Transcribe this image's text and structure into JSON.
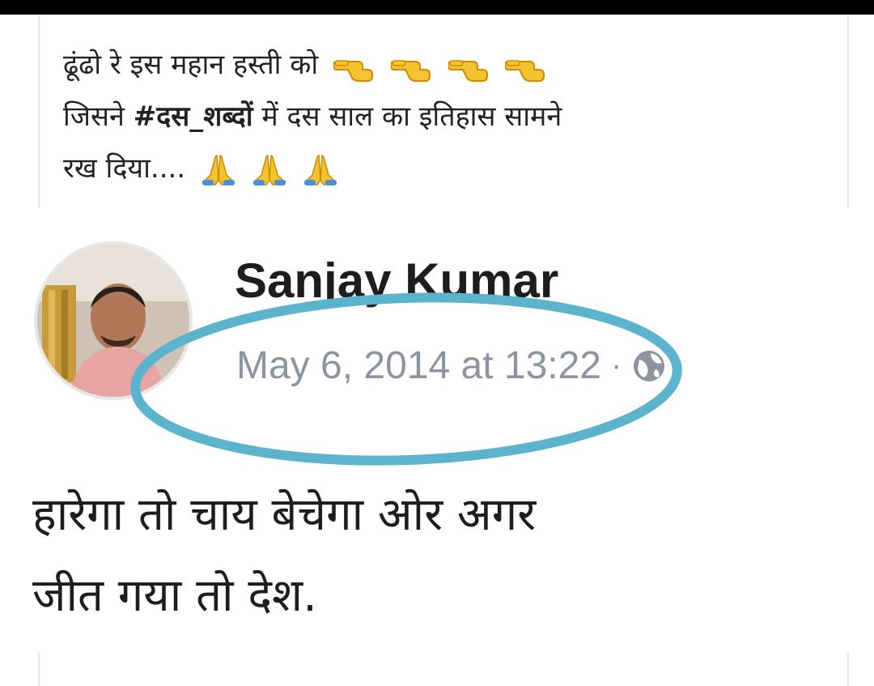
{
  "post": {
    "line1": "ढूंढो रे इस महान हस्ती को",
    "line2_before": "जिसने ",
    "line2_tag": "#दस_शब्दों",
    "line2_after": " में  दस साल का इतिहास सामने",
    "line3": "रख दिया....",
    "pointing_emoji_icon": "backhand-index-pointing-left-icon",
    "pointing_emoji_count": 4,
    "folded_hands_icon": "folded-hands-icon",
    "folded_hands_count": 3
  },
  "screenshot": {
    "author": "Sanjay Kumar",
    "timestamp": "May 6, 2014 at 13:22",
    "separator": "·",
    "privacy_icon": "globe-icon",
    "text_line1": "हारेगा तो चाय बेचेगा ओर अगर",
    "text_line2": "जीत गया तो देश.",
    "highlight_color": "#5bb3cc"
  },
  "colors": {
    "meta_grey": "#8d949e",
    "emoji_yellow": "#f4c430",
    "emoji_blue": "#4a90d9"
  }
}
